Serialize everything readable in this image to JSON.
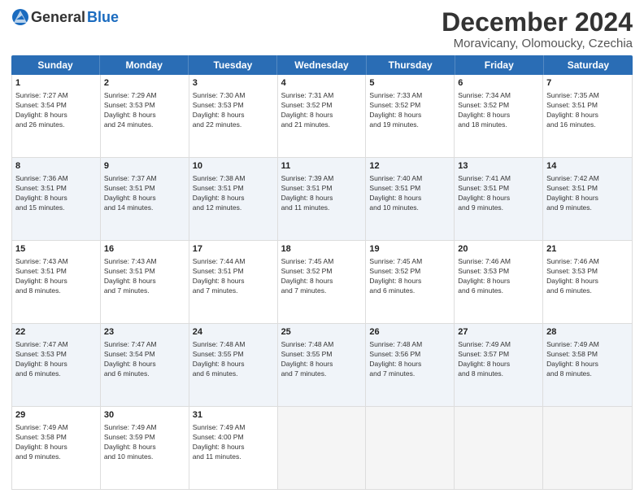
{
  "logo": {
    "general": "General",
    "blue": "Blue"
  },
  "title": "December 2024",
  "location": "Moravicany, Olomoucky, Czechia",
  "header_days": [
    "Sunday",
    "Monday",
    "Tuesday",
    "Wednesday",
    "Thursday",
    "Friday",
    "Saturday"
  ],
  "rows": [
    {
      "alt": false,
      "cells": [
        {
          "day": "1",
          "info": "Sunrise: 7:27 AM\nSunset: 3:54 PM\nDaylight: 8 hours\nand 26 minutes."
        },
        {
          "day": "2",
          "info": "Sunrise: 7:29 AM\nSunset: 3:53 PM\nDaylight: 8 hours\nand 24 minutes."
        },
        {
          "day": "3",
          "info": "Sunrise: 7:30 AM\nSunset: 3:53 PM\nDaylight: 8 hours\nand 22 minutes."
        },
        {
          "day": "4",
          "info": "Sunrise: 7:31 AM\nSunset: 3:52 PM\nDaylight: 8 hours\nand 21 minutes."
        },
        {
          "day": "5",
          "info": "Sunrise: 7:33 AM\nSunset: 3:52 PM\nDaylight: 8 hours\nand 19 minutes."
        },
        {
          "day": "6",
          "info": "Sunrise: 7:34 AM\nSunset: 3:52 PM\nDaylight: 8 hours\nand 18 minutes."
        },
        {
          "day": "7",
          "info": "Sunrise: 7:35 AM\nSunset: 3:51 PM\nDaylight: 8 hours\nand 16 minutes."
        }
      ]
    },
    {
      "alt": true,
      "cells": [
        {
          "day": "8",
          "info": "Sunrise: 7:36 AM\nSunset: 3:51 PM\nDaylight: 8 hours\nand 15 minutes."
        },
        {
          "day": "9",
          "info": "Sunrise: 7:37 AM\nSunset: 3:51 PM\nDaylight: 8 hours\nand 14 minutes."
        },
        {
          "day": "10",
          "info": "Sunrise: 7:38 AM\nSunset: 3:51 PM\nDaylight: 8 hours\nand 12 minutes."
        },
        {
          "day": "11",
          "info": "Sunrise: 7:39 AM\nSunset: 3:51 PM\nDaylight: 8 hours\nand 11 minutes."
        },
        {
          "day": "12",
          "info": "Sunrise: 7:40 AM\nSunset: 3:51 PM\nDaylight: 8 hours\nand 10 minutes."
        },
        {
          "day": "13",
          "info": "Sunrise: 7:41 AM\nSunset: 3:51 PM\nDaylight: 8 hours\nand 9 minutes."
        },
        {
          "day": "14",
          "info": "Sunrise: 7:42 AM\nSunset: 3:51 PM\nDaylight: 8 hours\nand 9 minutes."
        }
      ]
    },
    {
      "alt": false,
      "cells": [
        {
          "day": "15",
          "info": "Sunrise: 7:43 AM\nSunset: 3:51 PM\nDaylight: 8 hours\nand 8 minutes."
        },
        {
          "day": "16",
          "info": "Sunrise: 7:43 AM\nSunset: 3:51 PM\nDaylight: 8 hours\nand 7 minutes."
        },
        {
          "day": "17",
          "info": "Sunrise: 7:44 AM\nSunset: 3:51 PM\nDaylight: 8 hours\nand 7 minutes."
        },
        {
          "day": "18",
          "info": "Sunrise: 7:45 AM\nSunset: 3:52 PM\nDaylight: 8 hours\nand 7 minutes."
        },
        {
          "day": "19",
          "info": "Sunrise: 7:45 AM\nSunset: 3:52 PM\nDaylight: 8 hours\nand 6 minutes."
        },
        {
          "day": "20",
          "info": "Sunrise: 7:46 AM\nSunset: 3:53 PM\nDaylight: 8 hours\nand 6 minutes."
        },
        {
          "day": "21",
          "info": "Sunrise: 7:46 AM\nSunset: 3:53 PM\nDaylight: 8 hours\nand 6 minutes."
        }
      ]
    },
    {
      "alt": true,
      "cells": [
        {
          "day": "22",
          "info": "Sunrise: 7:47 AM\nSunset: 3:53 PM\nDaylight: 8 hours\nand 6 minutes."
        },
        {
          "day": "23",
          "info": "Sunrise: 7:47 AM\nSunset: 3:54 PM\nDaylight: 8 hours\nand 6 minutes."
        },
        {
          "day": "24",
          "info": "Sunrise: 7:48 AM\nSunset: 3:55 PM\nDaylight: 8 hours\nand 6 minutes."
        },
        {
          "day": "25",
          "info": "Sunrise: 7:48 AM\nSunset: 3:55 PM\nDaylight: 8 hours\nand 7 minutes."
        },
        {
          "day": "26",
          "info": "Sunrise: 7:48 AM\nSunset: 3:56 PM\nDaylight: 8 hours\nand 7 minutes."
        },
        {
          "day": "27",
          "info": "Sunrise: 7:49 AM\nSunset: 3:57 PM\nDaylight: 8 hours\nand 8 minutes."
        },
        {
          "day": "28",
          "info": "Sunrise: 7:49 AM\nSunset: 3:58 PM\nDaylight: 8 hours\nand 8 minutes."
        }
      ]
    },
    {
      "alt": false,
      "cells": [
        {
          "day": "29",
          "info": "Sunrise: 7:49 AM\nSunset: 3:58 PM\nDaylight: 8 hours\nand 9 minutes."
        },
        {
          "day": "30",
          "info": "Sunrise: 7:49 AM\nSunset: 3:59 PM\nDaylight: 8 hours\nand 10 minutes."
        },
        {
          "day": "31",
          "info": "Sunrise: 7:49 AM\nSunset: 4:00 PM\nDaylight: 8 hours\nand 11 minutes."
        },
        {
          "day": "",
          "info": ""
        },
        {
          "day": "",
          "info": ""
        },
        {
          "day": "",
          "info": ""
        },
        {
          "day": "",
          "info": ""
        }
      ]
    }
  ]
}
